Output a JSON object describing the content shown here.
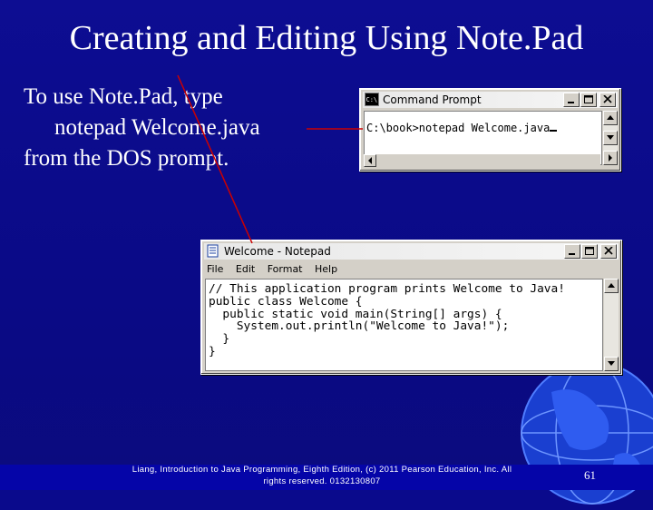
{
  "slide": {
    "title": "Creating and Editing Using Note.Pad",
    "body_lines": [
      "To use Note.Pad, type",
      "notepad Welcome.java",
      "from the DOS prompt."
    ],
    "footer_line1": "Liang, Introduction to Java Programming, Eighth Edition, (c) 2011 Pearson Education, Inc. All",
    "footer_line2": "rights reserved. 0132130807",
    "page_number": "61"
  },
  "command_prompt": {
    "icon_label": "C:\\",
    "title": "Command Prompt",
    "command_line": "C:\\book>notepad Welcome.java"
  },
  "notepad": {
    "title": "Welcome - Notepad",
    "menu": [
      "File",
      "Edit",
      "Format",
      "Help"
    ],
    "code_lines": [
      "// This application program prints Welcome to Java!",
      "public class Welcome {",
      "  public static void main(String[] args) {",
      "    System.out.println(\"Welcome to Java!\");",
      "  }",
      "}"
    ]
  },
  "colors": {
    "background": "#0a0a8c",
    "pointer_line": "#cc0000",
    "text": "#ffffff"
  }
}
